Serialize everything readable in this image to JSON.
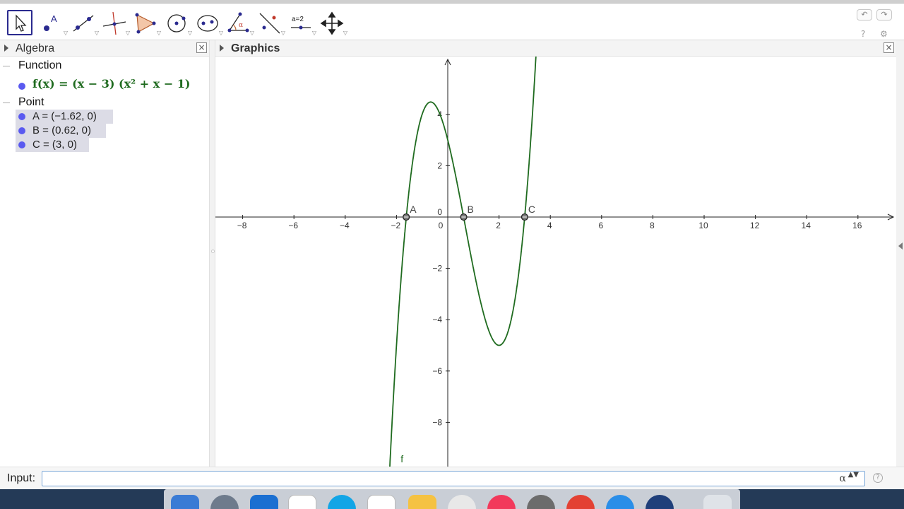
{
  "toolbar": {
    "tools": [
      {
        "name": "move-tool",
        "x": 10
      },
      {
        "name": "point-tool",
        "x": 55
      },
      {
        "name": "line-tool",
        "x": 99
      },
      {
        "name": "perpendicular-line-tool",
        "x": 143
      },
      {
        "name": "polygon-tool",
        "x": 187
      },
      {
        "name": "circle-center-point-tool",
        "x": 231
      },
      {
        "name": "ellipse-tool",
        "x": 275
      },
      {
        "name": "angle-tool",
        "x": 319
      },
      {
        "name": "reflect-tool",
        "x": 363
      },
      {
        "name": "slider-tool",
        "x": 407
      },
      {
        "name": "move-graphics-view-tool",
        "x": 451
      }
    ],
    "slider_label": "a=2",
    "undo": "↶",
    "redo": "↷",
    "help_glyph": "?",
    "settings_glyph": "⚙"
  },
  "algebra": {
    "title": "Algebra",
    "close": "×",
    "categories": {
      "function": "Function",
      "point": "Point"
    },
    "function_text": "f(x) = (x − 3) (x² + x − 1)",
    "points": [
      "A = (−1.62, 0)",
      "B = (0.62, 0)",
      "C = (3, 0)"
    ]
  },
  "graphics": {
    "title": "Graphics",
    "close": "×",
    "curve_label": "f",
    "point_labels": [
      "A",
      "B",
      "C"
    ],
    "x_ticks": [
      "−8",
      "−6",
      "−4",
      "−2",
      "0",
      "2",
      "4",
      "6",
      "8",
      "10",
      "12",
      "14",
      "16"
    ],
    "y_ticks": [
      "4",
      "2",
      "0",
      "−2",
      "−4",
      "−6",
      "−8"
    ],
    "colors": {
      "curve": "#1f6b1f",
      "axis": "#222222",
      "point_fill": "#7a7a7a"
    }
  },
  "chart_data": {
    "type": "line",
    "title": "",
    "xlabel": "",
    "ylabel": "",
    "xlim": [
      -9,
      17.5
    ],
    "ylim": [
      -9.5,
      6.3
    ],
    "grid": false,
    "series": [
      {
        "name": "f",
        "function": "(x - 3) * (x^2 + x - 1)",
        "x": [
          -2.2,
          -2.0,
          -1.62,
          -1.2,
          -0.8,
          -0.48,
          0.0,
          0.62,
          1.0,
          1.5,
          2.0,
          2.5,
          3.0,
          3.3
        ],
        "y": [
          -8.96,
          -5.0,
          0.0,
          3.26,
          4.46,
          4.73,
          3.0,
          0.0,
          -2.0,
          -4.13,
          -5.0,
          -3.38,
          0.0,
          3.54
        ]
      }
    ],
    "points": [
      {
        "label": "A",
        "x": -1.62,
        "y": 0
      },
      {
        "label": "B",
        "x": 0.62,
        "y": 0
      },
      {
        "label": "C",
        "x": 3,
        "y": 0
      }
    ]
  },
  "input": {
    "label": "Input:",
    "value": "",
    "alpha": "α",
    "spinner": "▲▼",
    "help": "?"
  }
}
